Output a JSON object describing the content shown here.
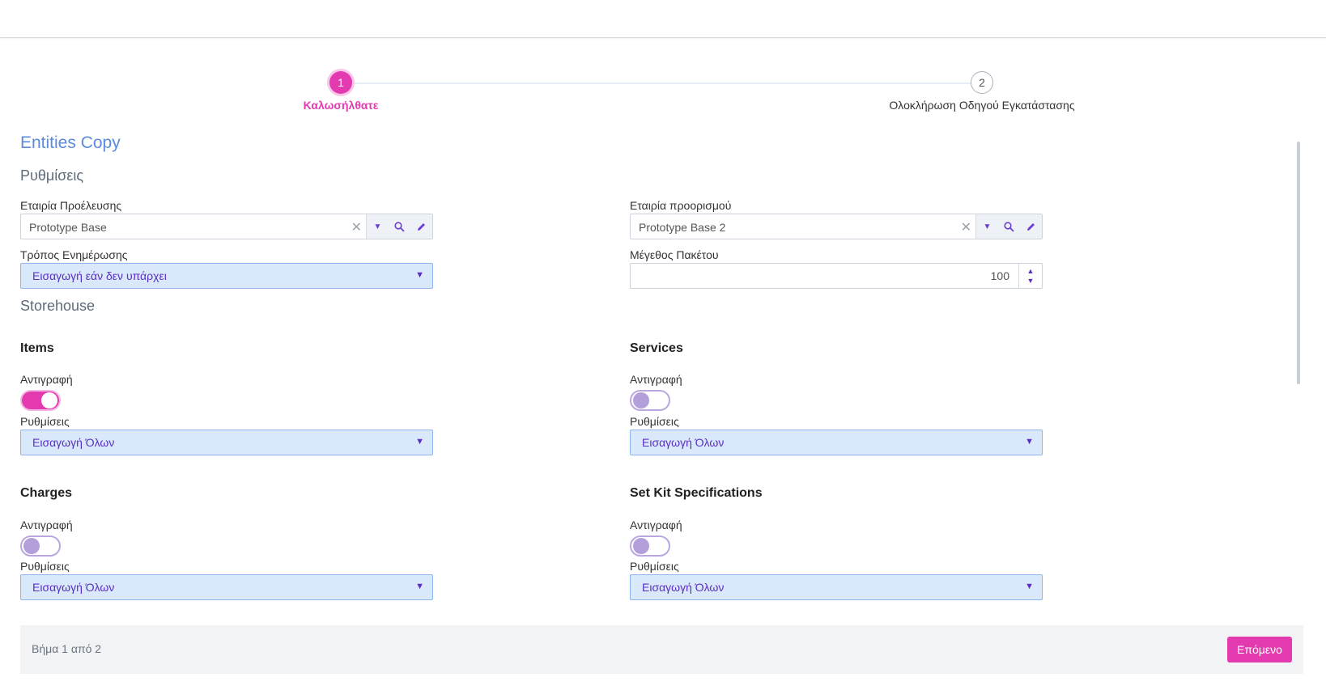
{
  "wizard": {
    "steps": [
      {
        "number": "1",
        "label": "Καλωσήλθατε"
      },
      {
        "number": "2",
        "label": "Ολοκλήρωση Οδηγού Εγκατάστασης"
      }
    ],
    "active_step": 1
  },
  "page": {
    "title": "Entities Copy",
    "settings_section": "Ρυθμίσεις"
  },
  "settings": {
    "source_company": {
      "label": "Εταιρία Προέλευσης",
      "value": "Prototype Base"
    },
    "target_company": {
      "label": "Εταιρία προορισμού",
      "value": "Prototype Base 2"
    },
    "update_mode": {
      "label": "Τρόπος Ενημέρωσης",
      "value": "Εισαγωγή εάν δεν υπάρχει"
    },
    "batch_size": {
      "label": "Μέγεθος Πακέτου",
      "value": "100"
    }
  },
  "storehouse": {
    "section": "Storehouse",
    "groups": [
      {
        "title": "Items",
        "copy_label": "Αντιγραφή",
        "copy_on": true,
        "settings_label": "Ρυθμίσεις",
        "settings_value": "Εισαγωγή Όλων"
      },
      {
        "title": "Services",
        "copy_label": "Αντιγραφή",
        "copy_on": false,
        "settings_label": "Ρυθμίσεις",
        "settings_value": "Εισαγωγή Όλων"
      },
      {
        "title": "Charges",
        "copy_label": "Αντιγραφή",
        "copy_on": false,
        "settings_label": "Ρυθμίσεις",
        "settings_value": "Εισαγωγή Όλων"
      },
      {
        "title": "Set Kit Specifications",
        "copy_label": "Αντιγραφή",
        "copy_on": false,
        "settings_label": "Ρυθμίσεις",
        "settings_value": "Εισαγωγή Όλων"
      }
    ]
  },
  "icons": {
    "clear": "✕",
    "dropdown": "▼",
    "search": "search-icon",
    "edit": "pencil-icon",
    "spin_up": "▲",
    "spin_down": "▼"
  },
  "footer": {
    "step_text": "Βήμα 1 από 2",
    "next_label": "Επόμενο"
  },
  "colors": {
    "accent": "#e43ab0",
    "title": "#5b8bdc",
    "select_bg": "#d9e8fb",
    "select_text": "#5a2fc2"
  }
}
